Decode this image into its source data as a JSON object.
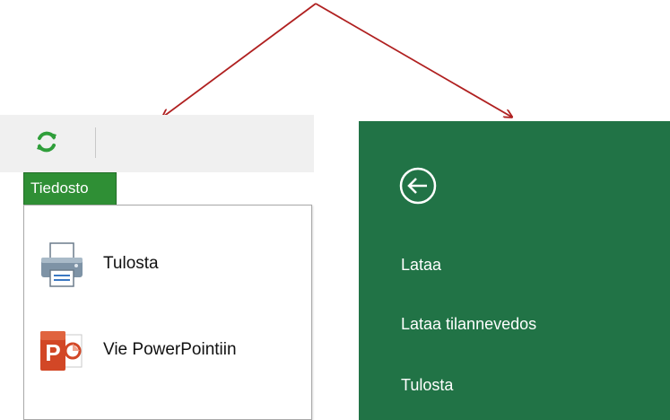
{
  "left_panel": {
    "toolbar": {
      "refresh_icon": "refresh-icon"
    },
    "file_tab_label": "Tiedosto",
    "menu_items": [
      {
        "label": "Tulosta",
        "icon": "printer-icon"
      },
      {
        "label": "Vie PowerPointiin",
        "icon": "powerpoint-icon"
      }
    ]
  },
  "right_panel": {
    "back_icon": "back-arrow-icon",
    "nav_items": [
      {
        "label": "Lataa"
      },
      {
        "label": "Lataa tilannevedos"
      },
      {
        "label": "Tulosta"
      }
    ]
  },
  "colors": {
    "arrow": "#b02020",
    "file_tab": "#2f8f35",
    "backstage": "#217346",
    "toolbar": "#f0f0f0"
  }
}
